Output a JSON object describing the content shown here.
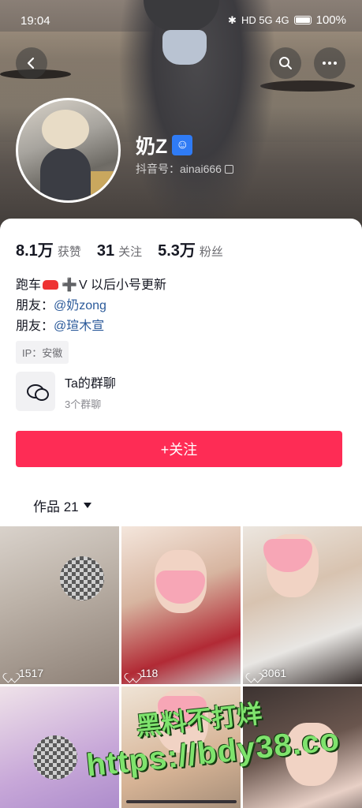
{
  "status_bar": {
    "time": "19:04",
    "battery_pct": "100%",
    "signal_text": "HD 5G 4G"
  },
  "header": {
    "back_icon": "chevron-left-icon",
    "search_icon": "search-icon",
    "more_icon": "more-dots-icon"
  },
  "profile": {
    "nickname": "奶Z",
    "badge_icon": "baby-icon",
    "douyin_id": "抖音号：ainai666",
    "stats": [
      {
        "num": "8.1万",
        "label": "获赞"
      },
      {
        "num": "31",
        "label": "关注"
      },
      {
        "num": "5.3万",
        "label": "粉丝"
      }
    ],
    "bio": {
      "line1_pre": "跑车",
      "line1_post": "V 以后小号更新",
      "friend_label": "朋友：",
      "friend1": "@奶zong",
      "friend2": "@瑄木宣"
    },
    "ip": "IP：安徽",
    "group": {
      "title": "Ta的群聊",
      "subtitle": "3个群聊"
    },
    "follow_label": "+关注",
    "works_tab": "作品 21"
  },
  "videos": [
    {
      "likes": "1517"
    },
    {
      "likes": "118"
    },
    {
      "likes": "3061"
    },
    {
      "likes": ""
    },
    {
      "likes": ""
    },
    {
      "likes": ""
    }
  ],
  "watermark": {
    "line1": "黑料不打烊",
    "line2": "https://bdy38.co"
  },
  "colors": {
    "accent": "#fe2c55",
    "link": "#2b5a9a",
    "badge": "#2f7bf5"
  }
}
